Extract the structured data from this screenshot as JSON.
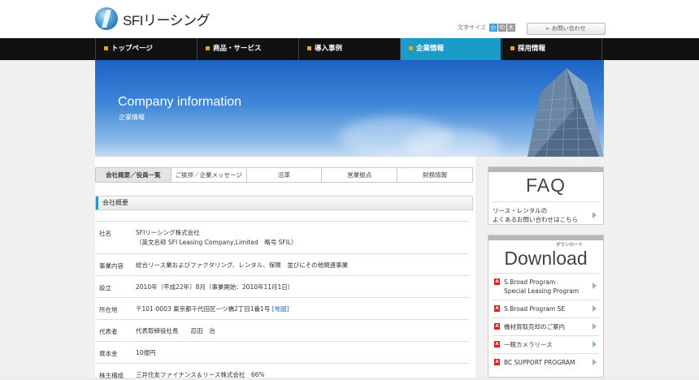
{
  "header": {
    "logo_text": "SFIリーシング",
    "fontsize_label": "文字サイズ",
    "fontsize_options": [
      "小",
      "中",
      "大"
    ],
    "contact_label": "お問い合わせ"
  },
  "nav": {
    "items": [
      {
        "label": "トップページ"
      },
      {
        "label": "商品・サービス"
      },
      {
        "label": "導入事例"
      },
      {
        "label": "企業情報"
      },
      {
        "label": "採用情報"
      }
    ]
  },
  "hero": {
    "title": "Company information",
    "subtitle": "企業情報"
  },
  "subtabs": [
    {
      "label": "会社概要／役員一覧"
    },
    {
      "label": "ご挨拶／企業メッセージ"
    },
    {
      "label": "沿革"
    },
    {
      "label": "営業拠点"
    },
    {
      "label": "財務情報"
    }
  ],
  "section": {
    "title": "会社概要"
  },
  "company": {
    "name_label": "社名",
    "name_line1": "SFIリーシング株式会社",
    "name_line2": "（英文名称 SFI Leasing Company,Limited　略号 SFIL）",
    "business_label": "事業内容",
    "business_value": "総合リース業およびファクタリング、レンタル、保険　並びにその他関連事業",
    "founded_label": "設立",
    "founded_value": "2010年（平成22年）8月（事業開始：2010年11月1日）",
    "address_label": "所在地",
    "address_value": "〒101-0003 東京都千代田区一ツ橋2丁目1番1号",
    "map_link": "[地図]",
    "rep_label": "代表者",
    "rep_value": "代表取締役社長　　忍田　治",
    "capital_label": "資本金",
    "capital_value": "10億円",
    "share_label": "株主構成",
    "share_value": "三井住友ファイナンス＆リース株式会社　66%"
  },
  "faq": {
    "title": "FAQ",
    "line1": "リース・レンタルの",
    "line2": "よくあるお問い合わせはこちら"
  },
  "download": {
    "title": "Download",
    "kana": "ダウンロード",
    "items": [
      {
        "line1": "S.Broad Program",
        "line2": "Special Leasing Program"
      },
      {
        "line1": "S.Broad Program SE",
        "line2": ""
      },
      {
        "line1": "機材買取売却のご案内",
        "line2": ""
      },
      {
        "line1": "一眼カメラリース",
        "line2": ""
      },
      {
        "line1": "BC SUPPORT PROGRAM",
        "line2": ""
      }
    ]
  },
  "colors": {
    "accent": "#1a9bc9",
    "nav_bg": "#111111",
    "nav_marker": "#f0a020"
  }
}
